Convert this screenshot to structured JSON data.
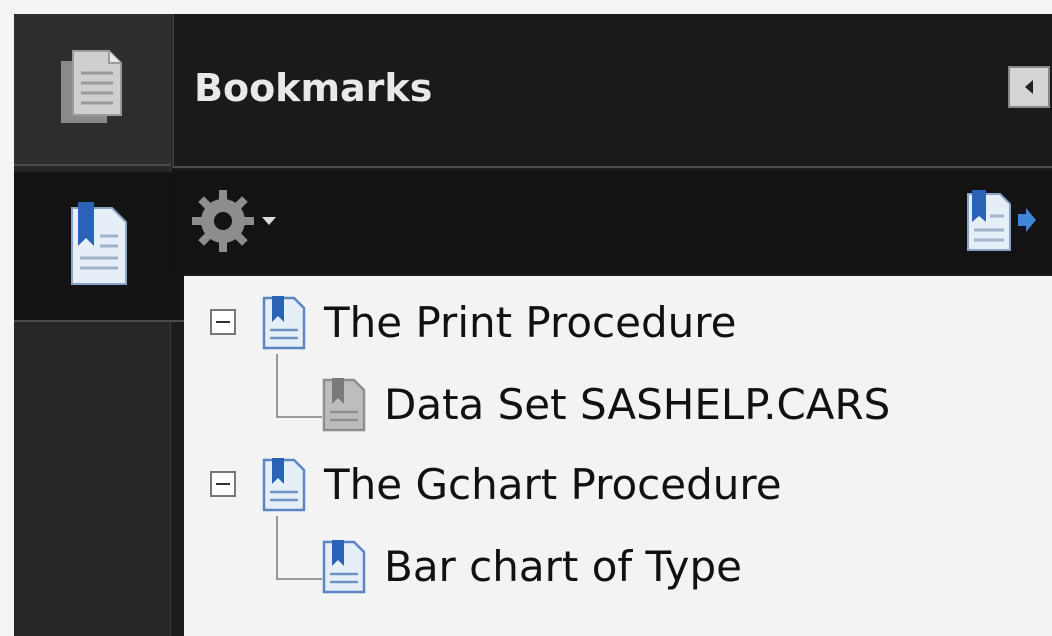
{
  "panel": {
    "title": "Bookmarks"
  },
  "tree": [
    {
      "label": "The Print Procedure",
      "expanded": true,
      "icon": "bookmark-blue-icon"
    },
    {
      "label": "Data Set SASHELP.CARS",
      "child": true,
      "icon": "bookmark-gray-icon"
    },
    {
      "label": "The Gchart Procedure",
      "expanded": true,
      "icon": "bookmark-blue-icon"
    },
    {
      "label": "Bar chart of Type",
      "child": true,
      "icon": "bookmark-blue-icon"
    }
  ],
  "colors": {
    "accent": "#2a63b5",
    "panel_bg": "#1c1c1c",
    "tree_bg": "#f3f3f3"
  }
}
